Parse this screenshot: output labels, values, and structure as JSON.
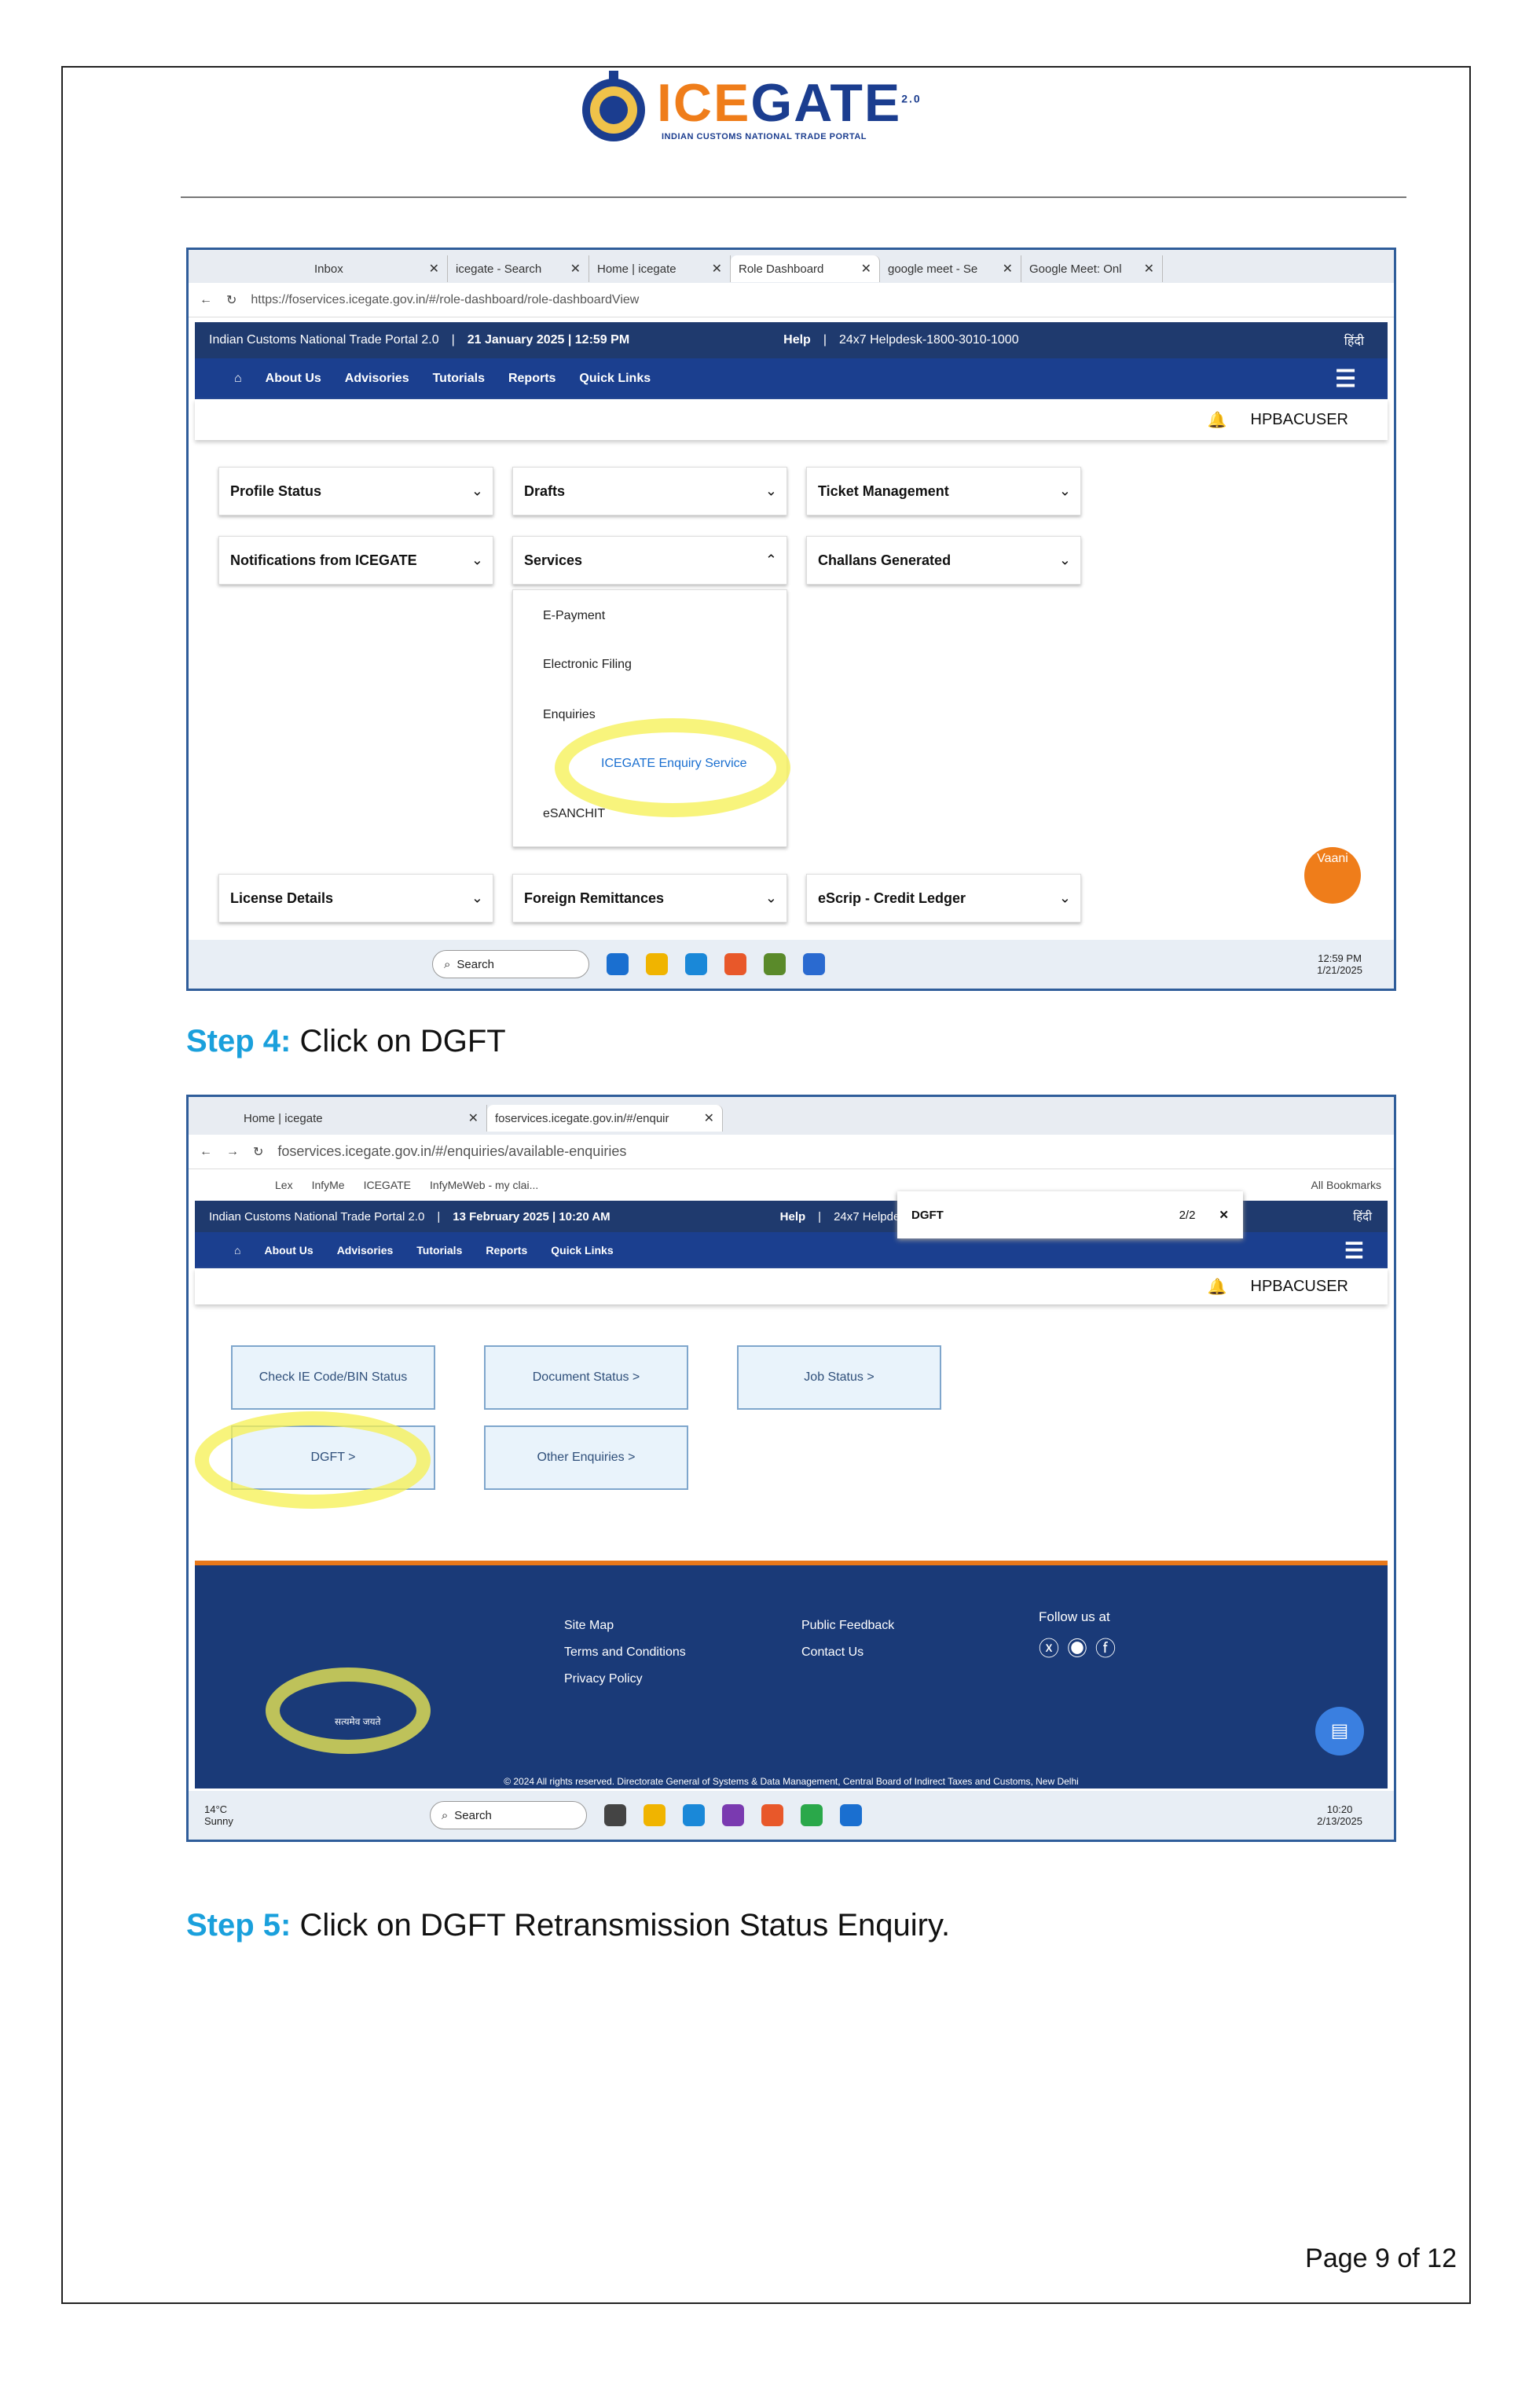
{
  "logo": {
    "text_a": "ICE",
    "text_b": "GATE",
    "sup": "2.0",
    "subtitle": "INDIAN CUSTOMS NATIONAL TRADE PORTAL"
  },
  "shot1": {
    "tabs": [
      "Inbox",
      "icegate - Search",
      "Home | icegate",
      "Role Dashboard",
      "google meet - Se",
      "Google Meet: Onl"
    ],
    "url": "https://foservices.icegate.gov.in/#/role-dashboard/role-dashboardView",
    "portal_title": "Indian Customs National Trade Portal 2.0",
    "date": "21 January 2025 | 12:59 PM",
    "help": "Help",
    "helpdesk": "24x7 Helpdesk-1800-3010-1000",
    "hindi": "हिंदी",
    "nav": [
      "About Us",
      "Advisories",
      "Tutorials",
      "Reports",
      "Quick Links"
    ],
    "user": "HPBACUSER",
    "cards": {
      "profile": "Profile Status",
      "drafts": "Drafts",
      "ticket": "Ticket Management",
      "notif": "Notifications from ICEGATE",
      "services": "Services",
      "challans": "Challans Generated",
      "license": "License Details",
      "foreign": "Foreign Remittances",
      "escrip": "eScrip - Credit Ledger"
    },
    "services_items": [
      "E-Payment",
      "Electronic Filing",
      "Enquiries",
      "ICEGATE Enquiry Service",
      "eSANCHIT"
    ],
    "vaani": "Vaani",
    "search": "Search",
    "time": "12:59 PM",
    "date_small": "1/21/2025"
  },
  "step4": {
    "label": "Step 4:",
    "text": " Click on DGFT"
  },
  "shot2": {
    "tabs": [
      "Home | icegate",
      "foservices.icegate.gov.in/#/enquir"
    ],
    "url": "foservices.icegate.gov.in/#/enquiries/available-enquiries",
    "bookmarks": [
      "Lex",
      "InfyMe",
      "ICEGATE",
      "InfyMeWeb - my clai...",
      "All Bookmarks"
    ],
    "find": "DGFT",
    "find_count": "2/2",
    "portal_title": "Indian Customs National Trade Portal 2.0",
    "date": "13 February 2025 | 10:20 AM",
    "help": "Help",
    "helpdesk": "24x7 Helpdesk-1800-3010-1000",
    "hindi": "हिंदी",
    "nav": [
      "About Us",
      "Advisories",
      "Tutorials",
      "Reports",
      "Quick Links"
    ],
    "user": "HPBACUSER",
    "buttons": [
      "Check IE Code/BIN Status",
      "Document Status >",
      "Job Status >",
      "DGFT >",
      "Other Enquiries >"
    ],
    "footer_links1": [
      "Site Map",
      "Terms and Conditions",
      "Privacy Policy"
    ],
    "footer_links2": [
      "Public Feedback",
      "Contact Us"
    ],
    "follow": "Follow us at",
    "motto": "सत्यमेव जयते",
    "copyright": "© 2024 All rights reserved. Directorate General of Systems & Data Management, Central Board of Indirect Taxes and Customs, New Delhi",
    "weather": "14°C",
    "weather2": "Sunny",
    "search": "Search",
    "time": "10:20",
    "date_small": "2/13/2025"
  },
  "step5": {
    "label": "Step 5:",
    "text": " Click on DGFT Retransmission Status Enquiry."
  },
  "page": "Page 9 of 12"
}
